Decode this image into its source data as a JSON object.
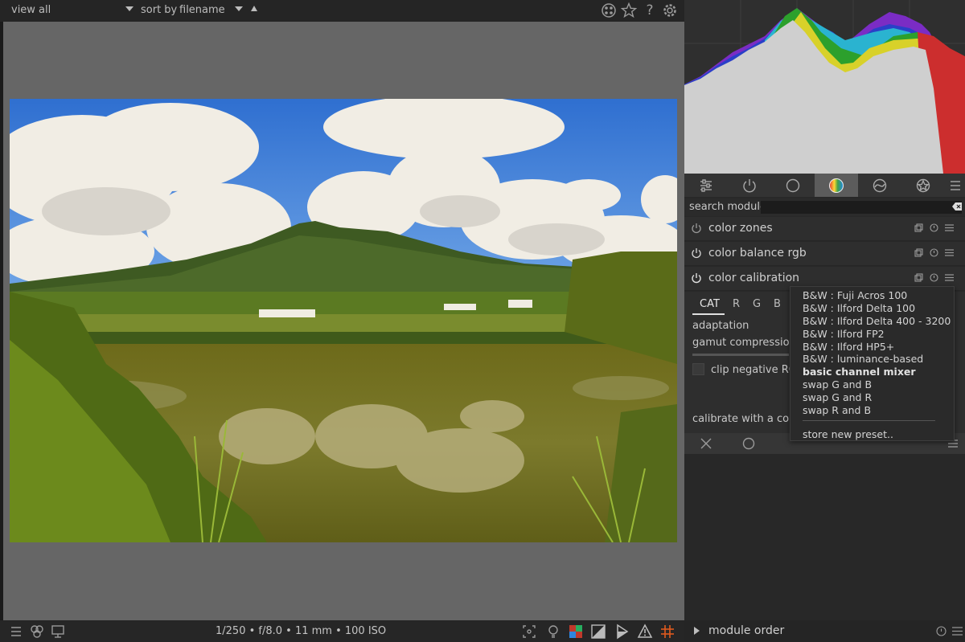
{
  "topbar": {
    "view_label": "view",
    "view_value": "all",
    "sort_label": "sort by",
    "sort_value": "filename",
    "icons": [
      "grouping-icon",
      "star-icon",
      "help-icon",
      "gear-icon"
    ]
  },
  "bottombar": {
    "exif": "1/250 • f/8.0 • 11 mm • 100 ISO",
    "left_icons": [
      "menu-icon",
      "color-assessment-icon",
      "display-icon"
    ],
    "right_icons": [
      "focus-peaking-icon",
      "bulb-icon",
      "color-check-icon",
      "overexposed-icon",
      "softproof-icon",
      "gamut-warning-icon",
      "guides-icon"
    ]
  },
  "right_panel": {
    "search_label": "search module",
    "search_value": "",
    "tabs": [
      "quick-access-icon",
      "active-modules-icon",
      "base-icon",
      "color-icon",
      "correct-icon",
      "effect-icon",
      "menu-icon"
    ],
    "modules": [
      {
        "label": "color zones"
      },
      {
        "label": "color balance rgb"
      },
      {
        "label": "color calibration"
      }
    ],
    "calibration": {
      "tabs": [
        "CAT",
        "R",
        "G",
        "B"
      ],
      "adaptation_label": "adaptation",
      "gamut_label": "gamut compression",
      "clip_label": "clip negative RGB",
      "calibrate_label": "calibrate with a color"
    },
    "module_order_label": "module order"
  },
  "presets_menu": {
    "items": [
      "B&W : Fuji Acros 100",
      "B&W : Ilford Delta 100",
      "B&W : Ilford Delta 400 - 3200",
      "B&W : Ilford FP2",
      "B&W : Ilford HP5+",
      "B&W : luminance-based",
      "basic channel mixer",
      "swap G and B",
      "swap G and R",
      "swap R and B"
    ],
    "selected": "basic channel mixer",
    "store_label": "store new preset.."
  },
  "colors": {
    "accent": "#e0e0e0",
    "panel": "#2e2e2e",
    "canvas": "#666666"
  }
}
